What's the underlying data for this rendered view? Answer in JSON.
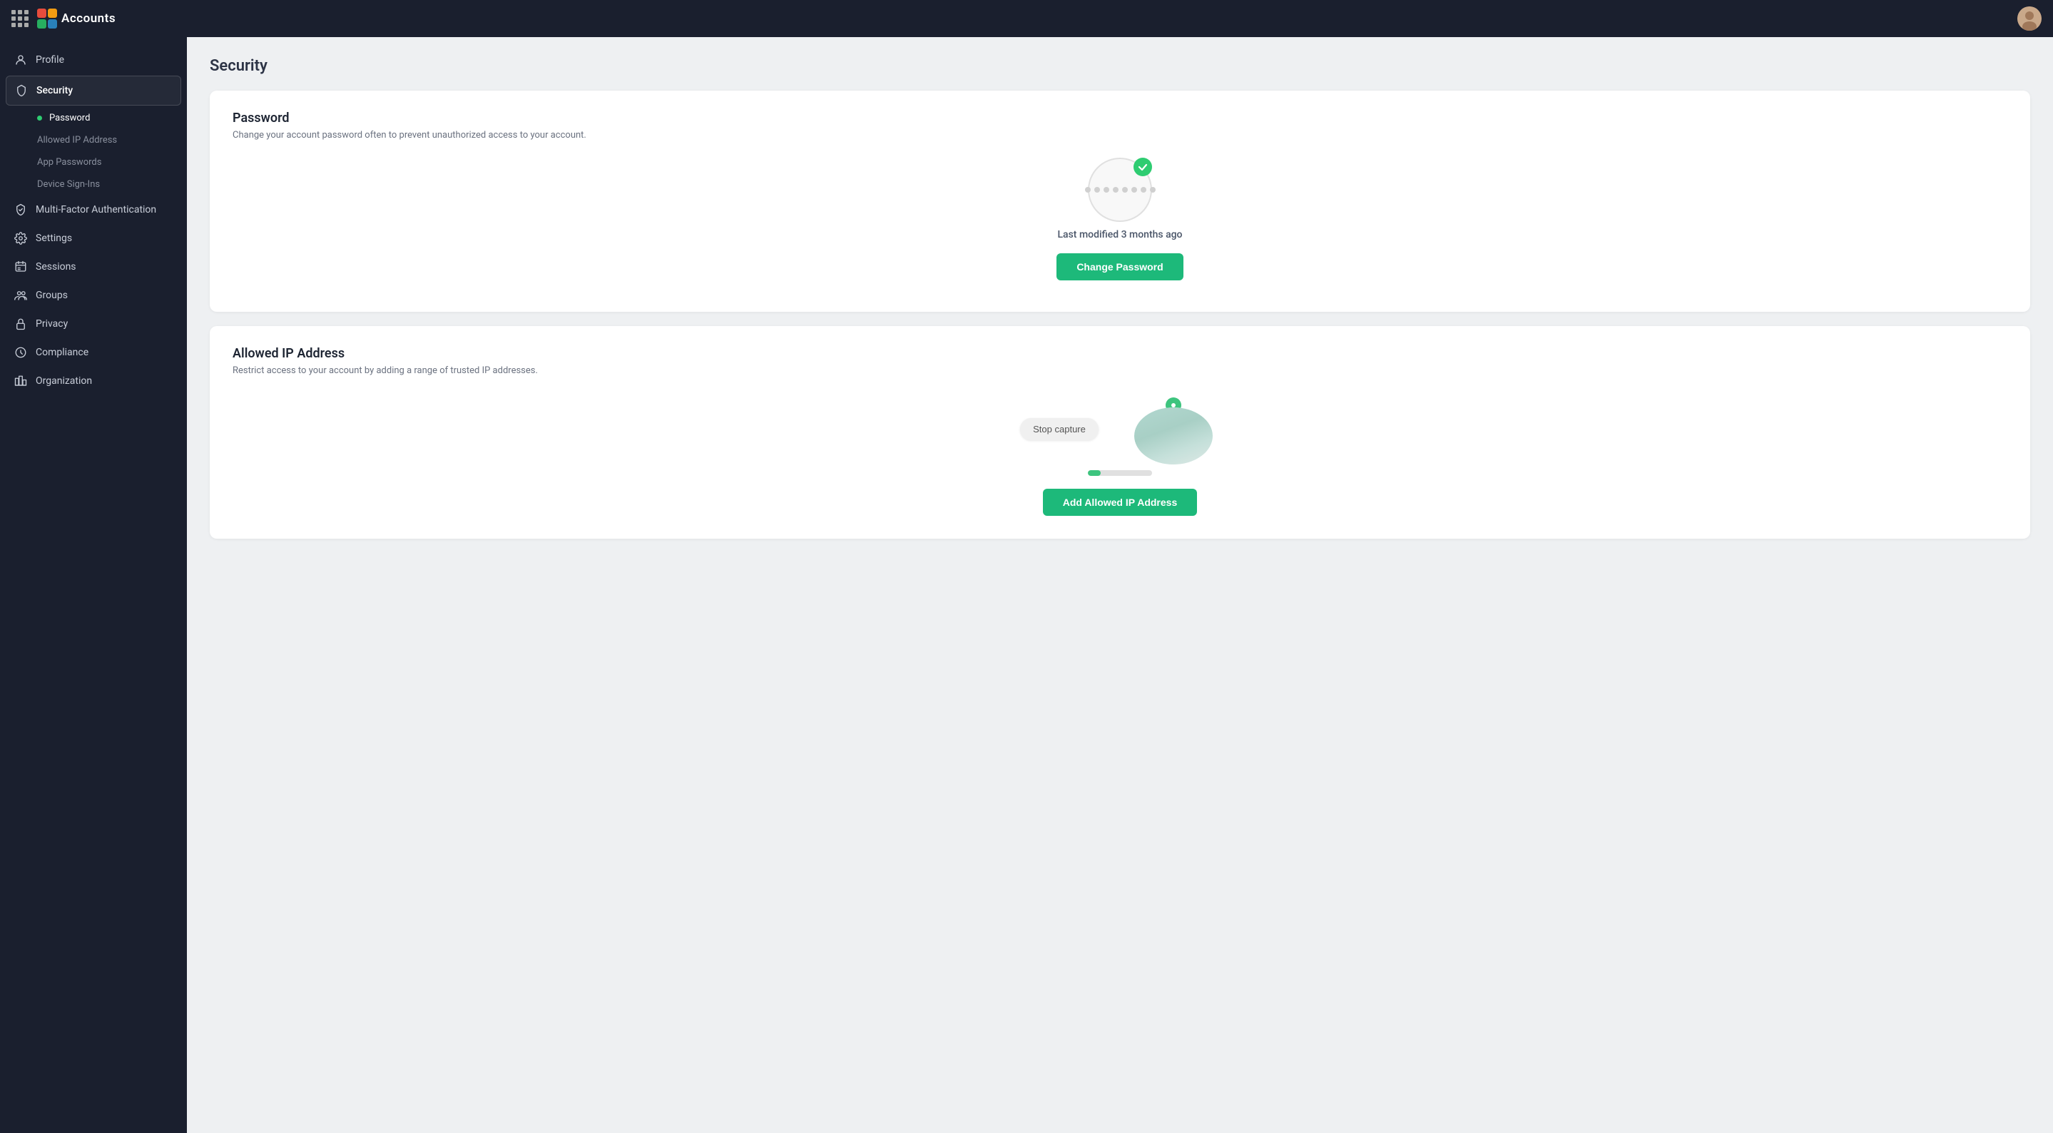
{
  "topbar": {
    "app_name": "Accounts",
    "grid_icon": "grid-icon"
  },
  "sidebar": {
    "items": [
      {
        "id": "profile",
        "label": "Profile",
        "icon": "user-icon"
      },
      {
        "id": "security",
        "label": "Security",
        "icon": "shield-icon",
        "active": true,
        "sub_items": [
          {
            "id": "password",
            "label": "Password",
            "active": true
          },
          {
            "id": "allowed-ip",
            "label": "Allowed IP Address"
          },
          {
            "id": "app-passwords",
            "label": "App Passwords"
          },
          {
            "id": "device-signins",
            "label": "Device Sign-Ins"
          }
        ]
      },
      {
        "id": "mfa",
        "label": "Multi-Factor Authentication",
        "icon": "shield-check-icon"
      },
      {
        "id": "settings",
        "label": "Settings",
        "icon": "settings-icon"
      },
      {
        "id": "sessions",
        "label": "Sessions",
        "icon": "sessions-icon"
      },
      {
        "id": "groups",
        "label": "Groups",
        "icon": "groups-icon"
      },
      {
        "id": "privacy",
        "label": "Privacy",
        "icon": "lock-icon"
      },
      {
        "id": "compliance",
        "label": "Compliance",
        "icon": "compliance-icon"
      },
      {
        "id": "organization",
        "label": "Organization",
        "icon": "org-icon"
      }
    ]
  },
  "main": {
    "page_title": "Security",
    "password_card": {
      "title": "Password",
      "description": "Change your account password often to prevent unauthorized access to your account.",
      "last_modified": "Last modified 3 months ago",
      "change_button": "Change Password"
    },
    "ip_card": {
      "title": "Allowed IP Address",
      "description": "Restrict access to your account by adding a range of trusted IP addresses.",
      "stop_capture_button": "Stop capture",
      "add_button": "Add Allowed IP Address"
    }
  }
}
